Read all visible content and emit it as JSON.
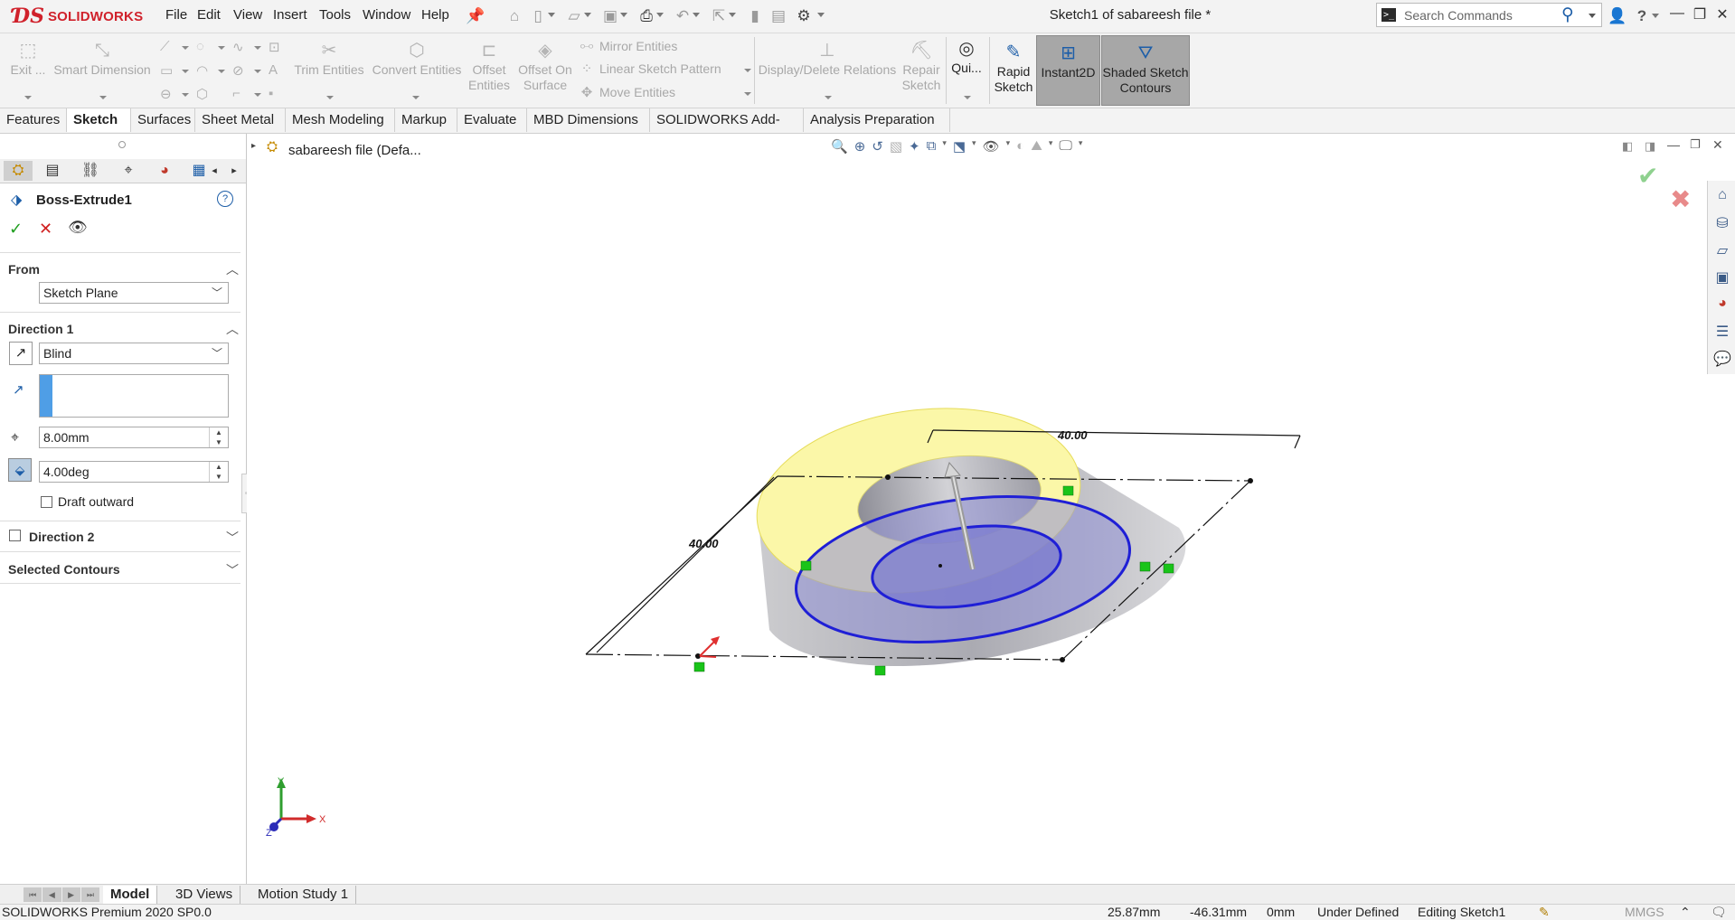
{
  "app": {
    "brand": "SOLIDWORKS",
    "title": "Sketch1 of sabareesh file *"
  },
  "menu": [
    "File",
    "Edit",
    "View",
    "Insert",
    "Tools",
    "Window",
    "Help"
  ],
  "search": {
    "placeholder": "Search Commands"
  },
  "commands": {
    "exit_sketch": "Exit ...",
    "smart_dimension": "Smart Dimension",
    "trim_entities": "Trim Entities",
    "convert_entities": "Convert Entities",
    "offset_entities_1": "Offset",
    "offset_entities_2": "Entities",
    "offset_on_surface_1": "Offset On",
    "offset_on_surface_2": "Surface",
    "mirror_entities": "Mirror Entities",
    "linear_sketch_pattern": "Linear Sketch Pattern",
    "move_entities": "Move Entities",
    "display_delete_relations": "Display/Delete Relations",
    "repair_sketch_1": "Repair",
    "repair_sketch_2": "Sketch",
    "quick_snaps": "Qui...",
    "rapid_sketch_1": "Rapid",
    "rapid_sketch_2": "Sketch",
    "instant2d": "Instant2D",
    "shaded_contours_1": "Shaded Sketch",
    "shaded_contours_2": "Contours"
  },
  "tabs": [
    "Features",
    "Sketch",
    "Surfaces",
    "Sheet Metal",
    "Mesh Modeling",
    "Markup",
    "Evaluate",
    "MBD Dimensions",
    "SOLIDWORKS Add-Ins",
    "Analysis Preparation"
  ],
  "active_tab": "Sketch",
  "feature_tree": {
    "root": "sabareesh file  (Defa..."
  },
  "property_manager": {
    "title": "Boss-Extrude1",
    "from": {
      "label": "From",
      "value": "Sketch Plane"
    },
    "direction1": {
      "label": "Direction 1",
      "end_condition": "Blind",
      "depth": "8.00mm",
      "draft_angle": "4.00deg",
      "draft_outward": "Draft outward"
    },
    "direction2": {
      "label": "Direction 2"
    },
    "selected_contours": {
      "label": "Selected Contours"
    }
  },
  "model": {
    "dim_top": "40.00",
    "dim_left": "40.00",
    "colors": {
      "top_face": "#fbf7a8",
      "sketch": "#1f1fd6",
      "side": "#a9a9b3",
      "relation": "#19c419"
    }
  },
  "triad": {
    "x": "X",
    "y": "Y",
    "z": "Z"
  },
  "bottom_tabs": [
    "Model",
    "3D Views",
    "Motion Study 1"
  ],
  "status": {
    "product": "SOLIDWORKS Premium 2020 SP0.0",
    "x": "25.87mm",
    "y": "-46.31mm",
    "z": "0mm",
    "state": "Under Defined",
    "mode": "Editing Sketch1",
    "units": "MMGS"
  }
}
